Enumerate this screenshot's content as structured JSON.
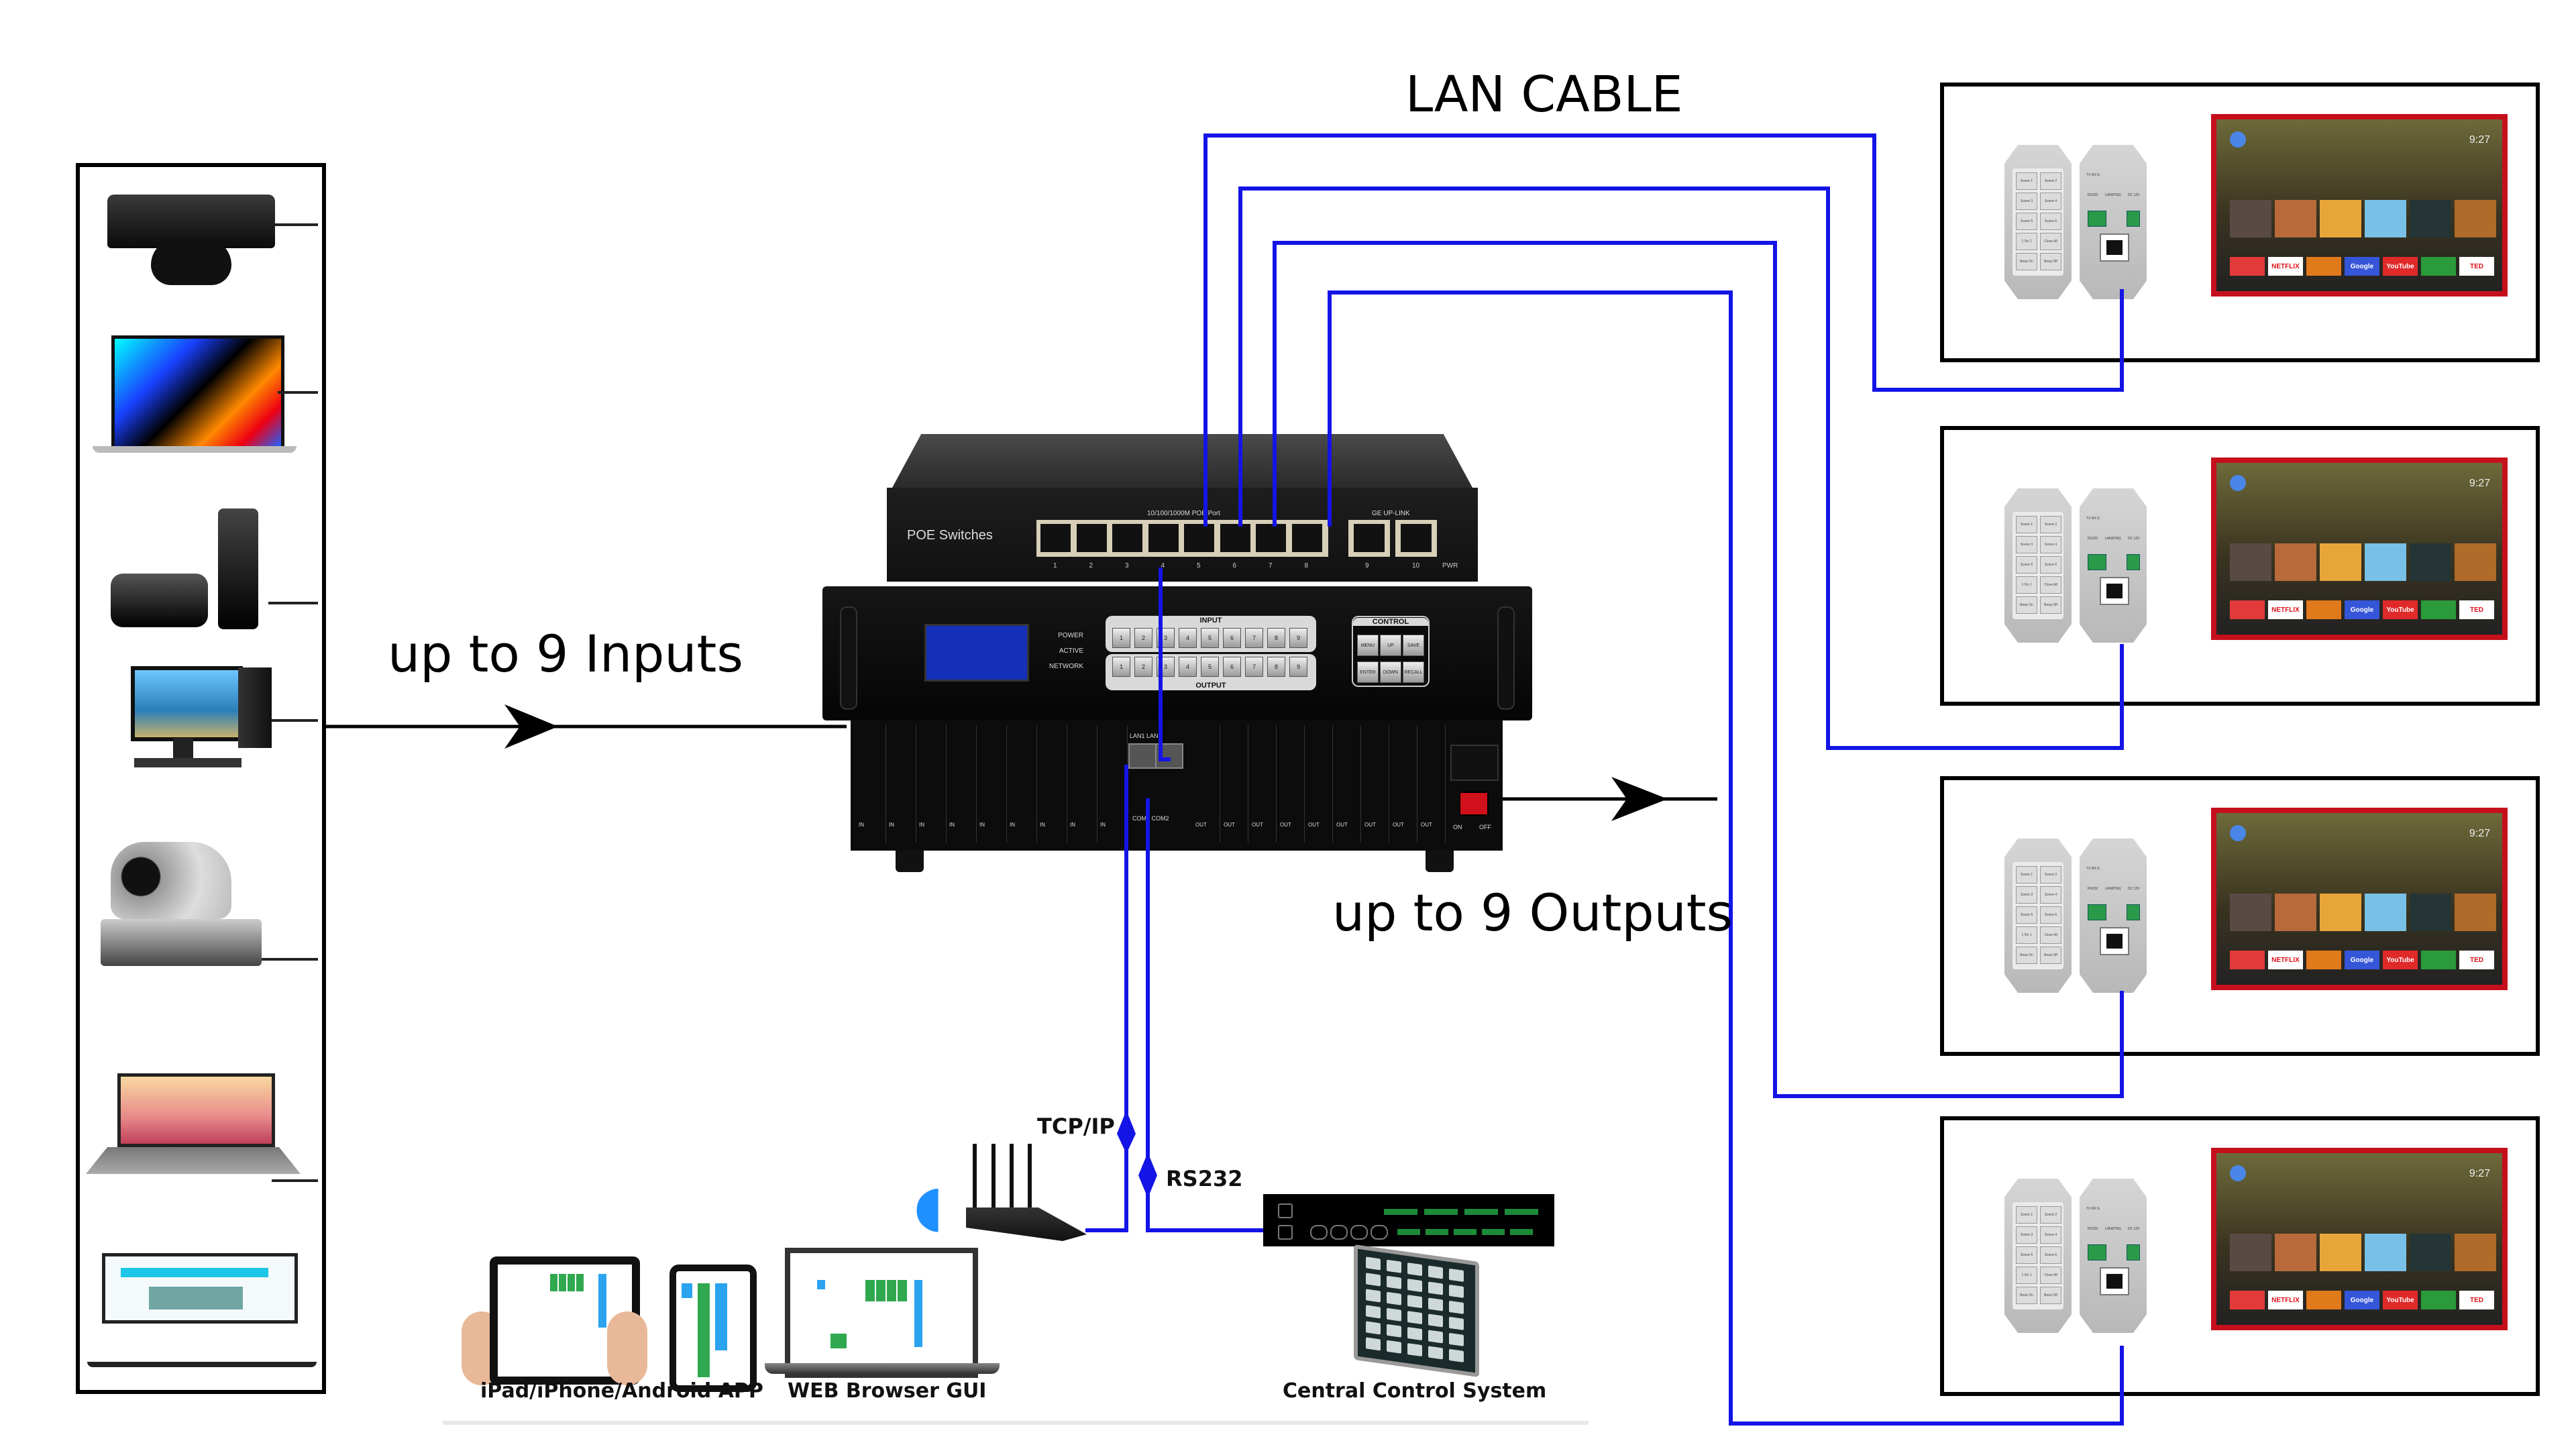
{
  "diagram": {
    "title_lan": "LAN CABLE",
    "inputs_label": "up to 9 Inputs",
    "outputs_label": "up to 9 Outputs",
    "link_tcpip": "TCP/IP",
    "link_rs232": "RS232",
    "wire_color": "#1414e6",
    "arrow_color": "#000000"
  },
  "sources": [
    {
      "name": "game-console",
      "icon": "xbox-console-icon"
    },
    {
      "name": "laptop",
      "icon": "macbook-icon"
    },
    {
      "name": "streaming-box",
      "icon": "apple-tv-icon"
    },
    {
      "name": "desktop-pc",
      "icon": "desktop-pc-icon"
    },
    {
      "name": "ptz-camera",
      "icon": "ptz-camera-icon"
    },
    {
      "name": "laptop",
      "icon": "laptop-icon"
    },
    {
      "name": "laptop-control-ui",
      "icon": "laptop-icon"
    }
  ],
  "poe_switch": {
    "label": "POE Switches",
    "poe_caption": "10/100/1000M POE Port",
    "uplink_caption": "GE UP-LINK",
    "ports": [
      "1",
      "2",
      "3",
      "4",
      "5",
      "6",
      "7",
      "8"
    ],
    "uplink_ports": [
      "9",
      "10"
    ],
    "pwr": "PWR"
  },
  "matrix_front": {
    "leds": [
      "POWER",
      "ACTIVE",
      "NETWORK"
    ],
    "input_title": "INPUT",
    "output_title": "OUTPUT",
    "input_keys": [
      "1",
      "2",
      "3",
      "4",
      "5",
      "6",
      "7",
      "8",
      "9"
    ],
    "output_keys": [
      "1",
      "2",
      "3",
      "4",
      "5",
      "6",
      "7",
      "8",
      "9"
    ],
    "control_title": "CONTROL",
    "control_keys": [
      "MENU",
      "UP",
      "SAVE",
      "ENTER",
      "DOWN",
      "RECALL"
    ]
  },
  "matrix_rear": {
    "in_cards": [
      "IN",
      "IN",
      "IN",
      "IN",
      "IN",
      "IN",
      "IN",
      "IN",
      "IN"
    ],
    "out_cards": [
      "OUT",
      "OUT",
      "OUT",
      "OUT",
      "OUT",
      "OUT",
      "OUT",
      "OUT",
      "OUT"
    ],
    "lan": "LAN1 LAN2",
    "com": "COM1 COM2",
    "power_on": "ON",
    "power_off": "OFF"
  },
  "control": {
    "mobile_label": "iPad/iPhone/Android APP",
    "web_label": "WEB Browser GUI",
    "ccs_label": "Central Control System"
  },
  "wall_panel": {
    "keys": [
      "Scene 1",
      "Scene 2",
      "Scene 3",
      "Scene 4",
      "Scene 5",
      "Scene 6",
      "1 On 1",
      "Close All",
      "Beep On",
      "Beep Off"
    ],
    "rear_rs232": "RS232",
    "rear_txrxg": "TX RX G",
    "rear_lan": "LAN(POE)",
    "rear_dc": "DC 12V"
  },
  "displays": [
    {
      "time": "9:27",
      "apps": [
        "",
        "NETFLIX",
        "",
        "Google",
        "YouTube",
        "",
        "TED"
      ]
    },
    {
      "time": "9:27",
      "apps": [
        "",
        "NETFLIX",
        "",
        "Google",
        "YouTube",
        "",
        "TED"
      ]
    },
    {
      "time": "9:27",
      "apps": [
        "",
        "NETFLIX",
        "",
        "Google",
        "YouTube",
        "",
        "TED"
      ]
    },
    {
      "time": "9:27",
      "apps": [
        "",
        "NETFLIX",
        "",
        "Google",
        "YouTube",
        "",
        "TED"
      ]
    }
  ]
}
